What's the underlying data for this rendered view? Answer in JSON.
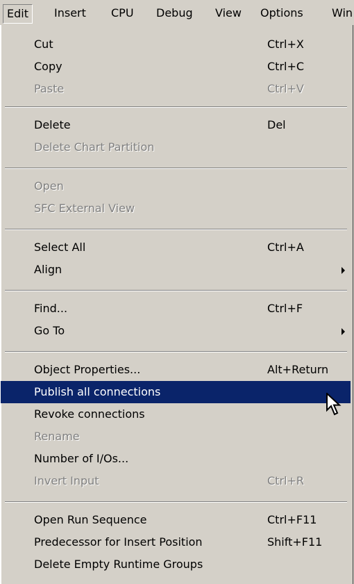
{
  "menubar": {
    "items": [
      "Edit",
      "Insert",
      "CPU",
      "Debug",
      "View",
      "Options",
      "Win"
    ]
  },
  "menu": {
    "cut": {
      "label": "Cut",
      "shortcut": "Ctrl+X"
    },
    "copy": {
      "label": "Copy",
      "shortcut": "Ctrl+C"
    },
    "paste": {
      "label": "Paste",
      "shortcut": "Ctrl+V"
    },
    "delete": {
      "label": "Delete",
      "shortcut": "Del"
    },
    "delete_chart_partition": {
      "label": "Delete Chart Partition"
    },
    "open": {
      "label": "Open"
    },
    "sfc_external_view": {
      "label": "SFC External View"
    },
    "select_all": {
      "label": "Select All",
      "shortcut": "Ctrl+A"
    },
    "align": {
      "label": "Align"
    },
    "find": {
      "label": "Find...",
      "shortcut": "Ctrl+F"
    },
    "go_to": {
      "label": "Go To"
    },
    "object_properties": {
      "label": "Object Properties...",
      "shortcut": "Alt+Return"
    },
    "publish_all_connections": {
      "label": "Publish all connections"
    },
    "revoke_connections": {
      "label": "Revoke connections"
    },
    "rename": {
      "label": "Rename"
    },
    "number_of_ios": {
      "label": "Number of I/Os..."
    },
    "invert_input": {
      "label": "Invert Input",
      "shortcut": "Ctrl+R"
    },
    "open_run_sequence": {
      "label": "Open Run Sequence",
      "shortcut": "Ctrl+F11"
    },
    "predecessor": {
      "label": "Predecessor for Insert Position",
      "shortcut": "Shift+F11"
    },
    "delete_empty_runtime_groups": {
      "label": "Delete Empty Runtime Groups"
    }
  },
  "colors": {
    "menu_bg": "#d4d0c8",
    "highlight_bg": "#0a246a",
    "disabled_text": "#808080"
  }
}
